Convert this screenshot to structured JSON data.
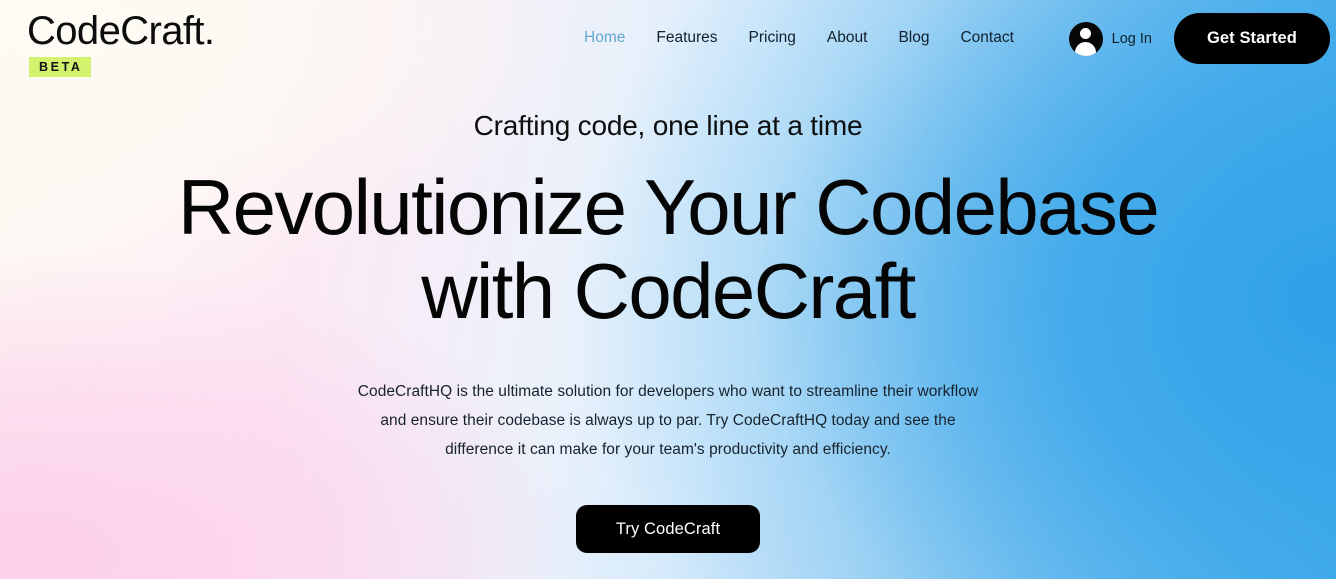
{
  "brand": {
    "name": "CodeCraft.",
    "badge": "BETA"
  },
  "nav": {
    "items": [
      {
        "label": "Home",
        "active": true
      },
      {
        "label": "Features",
        "active": false
      },
      {
        "label": "Pricing",
        "active": false
      },
      {
        "label": "About",
        "active": false
      },
      {
        "label": "Blog",
        "active": false
      },
      {
        "label": "Contact",
        "active": false
      }
    ]
  },
  "auth": {
    "avatar_icon": "user-avatar-icon",
    "login_label": "Log In",
    "cta_label": "Get Started"
  },
  "hero": {
    "eyebrow": "Crafting code, one line at a time",
    "title_line1": "Revolutionize Your Codebase",
    "title_line2": "with CodeCraft",
    "description": "CodeCraftHQ is the ultimate solution for developers who want to streamline their workflow and ensure their codebase is always up to par. Try CodeCraftHQ today and see the difference it can make for your team's productivity and efficiency.",
    "cta_label": "Try CodeCraft"
  },
  "colors": {
    "badge_bg": "#d3f26d",
    "button_bg": "#000000",
    "button_text": "#ffffff",
    "nav_active": "#63a9cf",
    "nav_text": "#11202c",
    "gradient_warm_white": "#fdf9f2",
    "gradient_pink": "#fcceea",
    "gradient_blue": "#34a3e8"
  }
}
